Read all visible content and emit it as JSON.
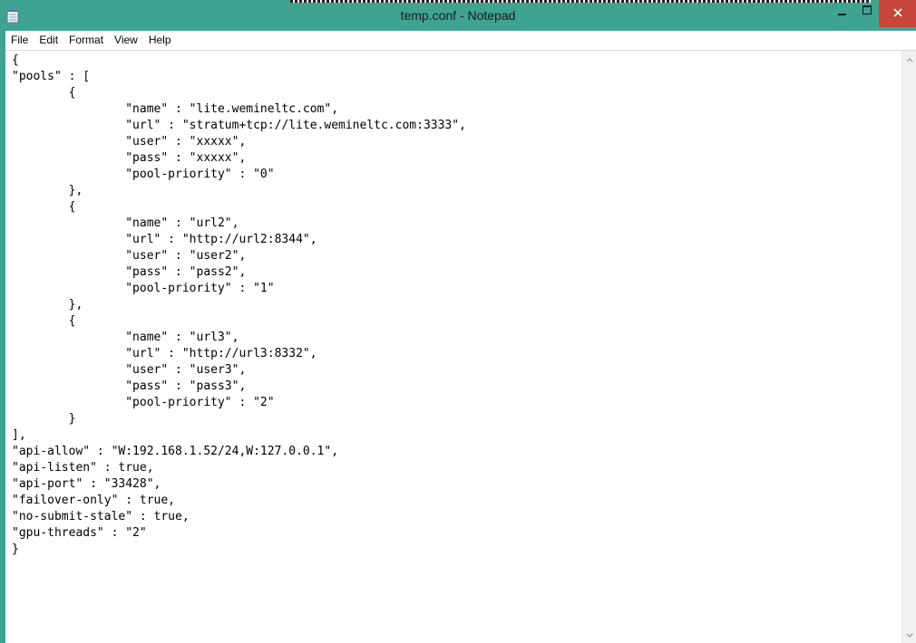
{
  "window": {
    "title": "temp.conf - Notepad"
  },
  "menu": {
    "items": [
      "File",
      "Edit",
      "Format",
      "View",
      "Help"
    ]
  },
  "editor": {
    "lines": [
      "{",
      "\"pools\" : [",
      "        {",
      "                \"name\" : \"lite.wemineltc.com\",",
      "                \"url\" : \"stratum+tcp://lite.wemineltc.com:3333\",",
      "                \"user\" : \"xxxxx\",",
      "                \"pass\" : \"xxxxx\",",
      "                \"pool-priority\" : \"0\"",
      "        },",
      "        {",
      "                \"name\" : \"url2\",",
      "                \"url\" : \"http://url2:8344\",",
      "                \"user\" : \"user2\",",
      "                \"pass\" : \"pass2\",",
      "                \"pool-priority\" : \"1\"",
      "        },",
      "        {",
      "                \"name\" : \"url3\",",
      "                \"url\" : \"http://url3:8332\",",
      "                \"user\" : \"user3\",",
      "                \"pass\" : \"pass3\",",
      "                \"pool-priority\" : \"2\"",
      "        }",
      "],",
      "\"api-allow\" : \"W:192.168.1.52/24,W:127.0.0.1\",",
      "\"api-listen\" : true,",
      "\"api-port\" : \"33428\",",
      "\"failover-only\" : true,",
      "\"no-submit-stale\" : true,",
      "\"gpu-threads\" : \"2\"",
      "}"
    ]
  },
  "icons": {
    "app": "notepad-icon",
    "minimize": "minimize-icon",
    "maximize": "maximize-icon",
    "close": "close-icon",
    "scroll_up": "chevron-up-icon",
    "scroll_down": "chevron-down-icon"
  },
  "colors": {
    "titlebar": "#3fa392",
    "close_button": "#c7453a"
  }
}
